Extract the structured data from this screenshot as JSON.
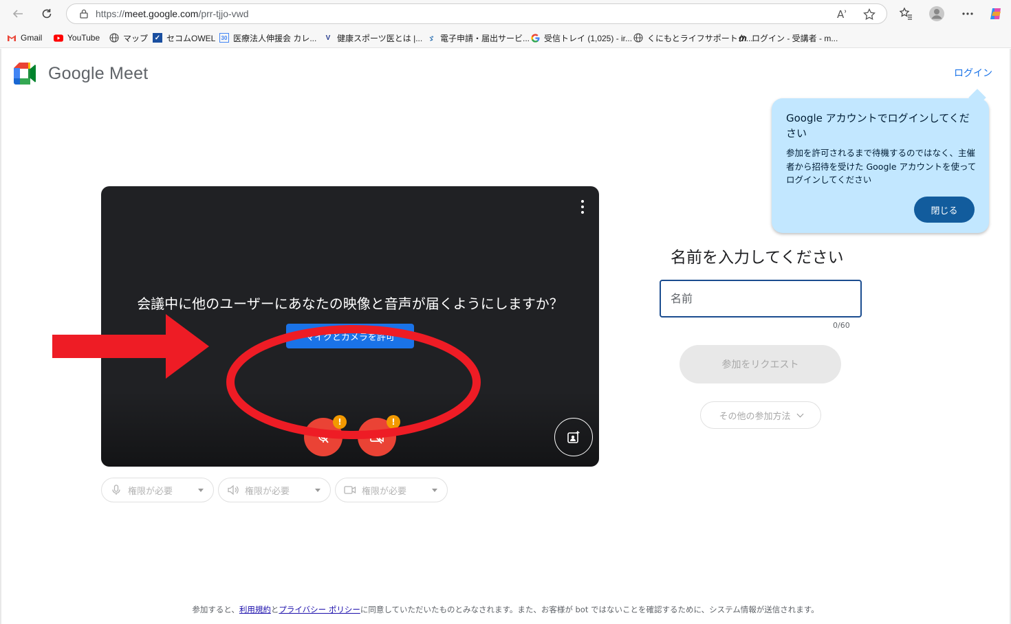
{
  "browser": {
    "url_scheme": "https://",
    "url_host": "meet.google.com",
    "url_path": "/prr-tjjo-vwd",
    "read_aloud_label": "Aʾ"
  },
  "bookmarks": [
    {
      "label": "Gmail",
      "icon": "gmail-icon"
    },
    {
      "label": "YouTube",
      "icon": "youtube-icon"
    },
    {
      "label": "マップ",
      "icon": "globe-icon"
    },
    {
      "label": "セコムOWEL",
      "icon": "secom-icon"
    },
    {
      "label": "医療法人伸援会 カレ...",
      "icon": "calendar-icon"
    },
    {
      "label": "健康スポーツ医とは |...",
      "icon": "site-icon"
    },
    {
      "label": "電子申請・届出サービ...",
      "icon": "site-icon"
    },
    {
      "label": "受信トレイ (1,025) - ir...",
      "icon": "google-icon"
    },
    {
      "label": "くにもとライフサポートク...",
      "icon": "globe-icon"
    },
    {
      "label": "ログイン - 受講者 - m...",
      "icon": "m-icon"
    }
  ],
  "header": {
    "brand": "Google Meet",
    "login_link": "ログイン"
  },
  "bubble": {
    "title": "Google アカウントでログインしてください",
    "body": "参加を許可されるまで待機するのではなく、主催者から招待を受けた Google アカウントを使ってログインしてください",
    "close_label": "閉じる"
  },
  "video": {
    "question": "会議中に他のユーザーにあなたの映像と音声が届くようにしますか？",
    "allow_label": "マイクとカメラを許可",
    "warn_symbol": "!"
  },
  "devices": [
    {
      "label": "権限が必要",
      "icon": "microphone-icon"
    },
    {
      "label": "権限が必要",
      "icon": "speaker-icon"
    },
    {
      "label": "権限が必要",
      "icon": "camera-icon"
    }
  ],
  "join": {
    "title": "名前を入力してください",
    "name_placeholder": "名前",
    "name_value": "",
    "counter": "0/60",
    "request_label": "参加をリクエスト",
    "other_label": "その他の参加方法"
  },
  "footer": {
    "prefix": "参加すると、",
    "terms": "利用規約",
    "and": "と",
    "privacy": "プライバシー ポリシー",
    "suffix": "に同意していただいたものとみなされます。また、お客様が bot ではないことを確認するために、システム情報が送信されます。"
  },
  "colors": {
    "accent": "#1a73e8",
    "bubble": "#c2e7ff",
    "danger": "#ea4335",
    "annotation": "#ee1c25"
  }
}
